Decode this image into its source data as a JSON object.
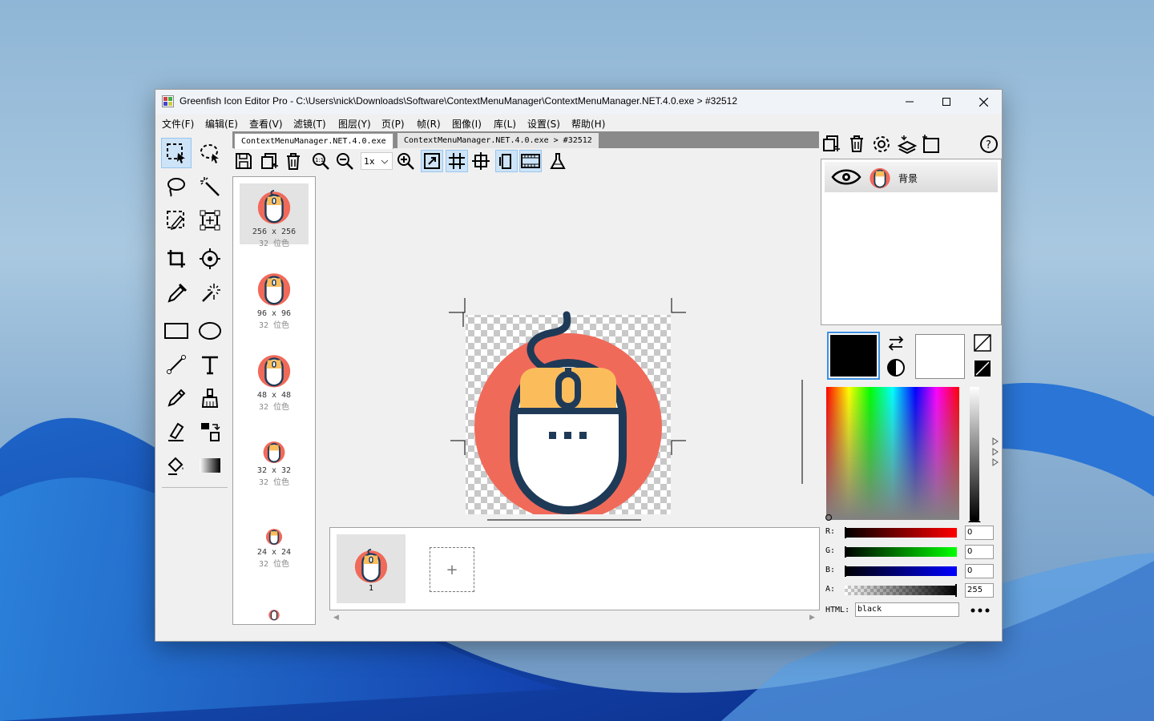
{
  "window": {
    "title": "Greenfish Icon Editor Pro - C:\\Users\\nick\\Downloads\\Software\\ContextMenuManager\\ContextMenuManager.NET.4.0.exe > #32512"
  },
  "menu": [
    "文件(F)",
    "编辑(E)",
    "查看(V)",
    "滤镜(T)",
    "图层(Y)",
    "页(P)",
    "帧(R)",
    "图像(I)",
    "库(L)",
    "设置(S)",
    "帮助(H)"
  ],
  "tabs": [
    {
      "label": "ContextMenuManager.NET.4.0.exe",
      "active": true
    },
    {
      "label": "ContextMenuManager.NET.4.0.exe > #32512",
      "active": false
    }
  ],
  "toolbar": {
    "zoom": "1x"
  },
  "sizes": [
    {
      "dims": "256 x 256",
      "bits": "32 位色",
      "selected": true
    },
    {
      "dims": "96 x 96",
      "bits": "32 位色",
      "selected": false
    },
    {
      "dims": "48 x 48",
      "bits": "32 位色",
      "selected": false
    },
    {
      "dims": "32 x 32",
      "bits": "32 位色",
      "selected": false
    },
    {
      "dims": "24 x 24",
      "bits": "32 位色",
      "selected": false
    }
  ],
  "frames": [
    {
      "label": "1"
    }
  ],
  "frames_add": "+",
  "layers": [
    {
      "name": "背景",
      "visible": true
    }
  ],
  "color": {
    "primary": "#000000",
    "secondary": "#ffffff",
    "r_label": "R:",
    "r": "0",
    "g_label": "G:",
    "g": "0",
    "b_label": "B:",
    "b": "0",
    "a_label": "A:",
    "a": "255",
    "html_label": "HTML:",
    "html": "black"
  },
  "icon_colors": {
    "circle": "#f06a5a",
    "top": "#fbbd5c",
    "body": "#ffffff",
    "outline": "#1f3a57"
  }
}
